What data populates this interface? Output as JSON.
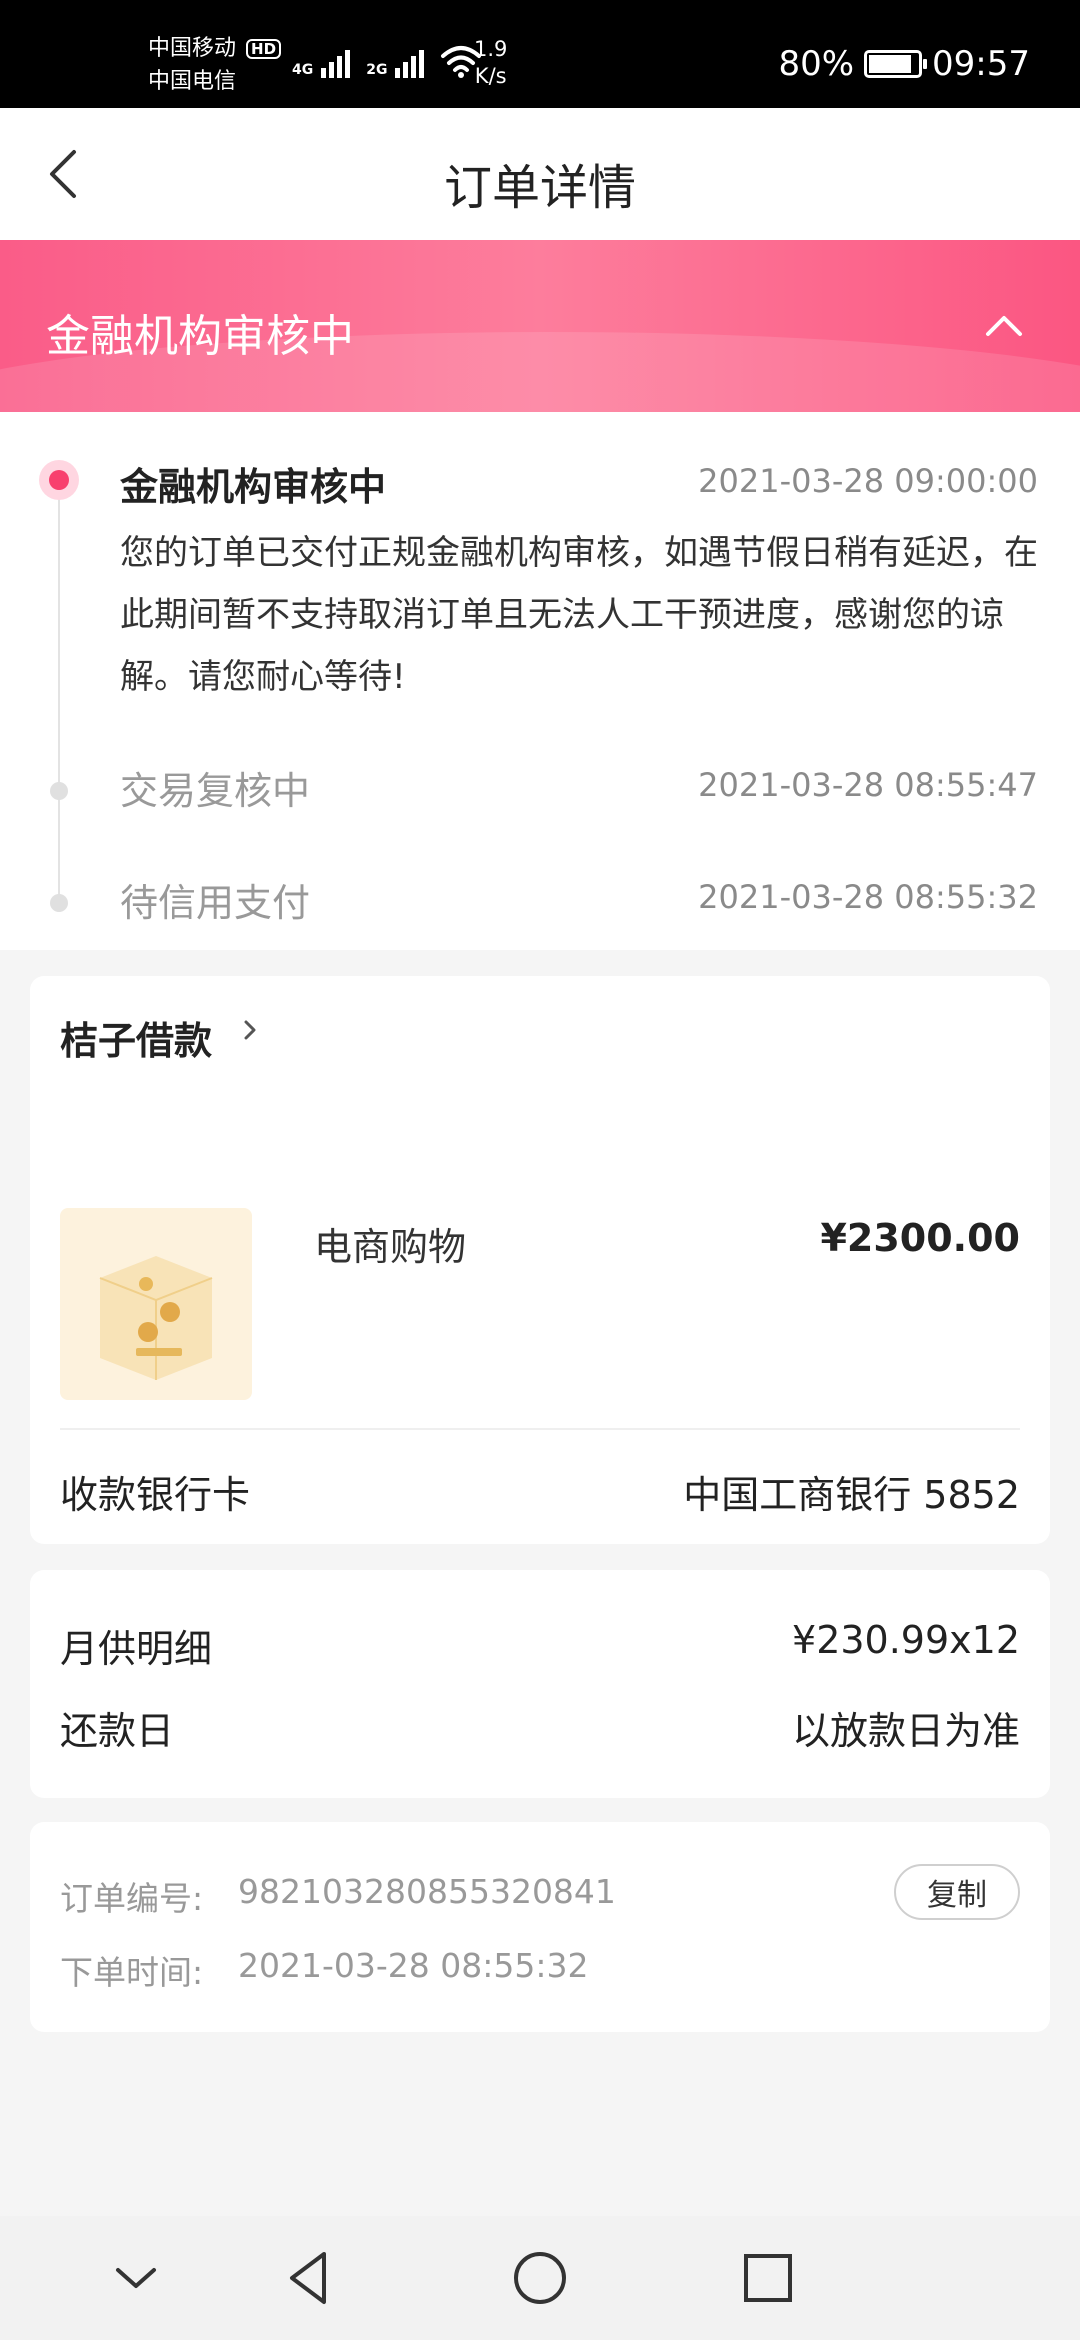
{
  "status_bar": {
    "carrier_1": "中国移动",
    "hd_badge": "HD",
    "carrier_2": "中国电信",
    "net_1": "4G",
    "net_2": "2G",
    "speed_value": "1.9",
    "speed_unit": "K/s",
    "battery_percent": "80%",
    "battery_level": 0.8,
    "time": "09:57"
  },
  "header": {
    "title": "订单详情"
  },
  "banner": {
    "title": "金融机构审核中",
    "background_color": "#fa5c88"
  },
  "timeline": {
    "active": {
      "title": "金融机构审核中",
      "time": "2021-03-28 09:00:00",
      "description": "您的订单已交付正规金融机构审核，如遇节假日稍有延迟，在此期间暂不支持取消订单且无法人工干预进度，感谢您的谅解。请您耐心等待!"
    },
    "steps": [
      {
        "title": "交易复核中",
        "time": "2021-03-28 08:55:47"
      },
      {
        "title": "待信用支付",
        "time": "2021-03-28 08:55:32"
      }
    ]
  },
  "loan_card": {
    "title": "桔子借款",
    "product_name": "电商购物",
    "price": "¥2300.00",
    "bank_label": "收款银行卡",
    "bank_value": "中国工商银行 5852"
  },
  "repay_card": {
    "monthly_label": "月供明细",
    "monthly_value": "¥230.99x12",
    "due_label": "还款日",
    "due_value": "以放款日为准"
  },
  "order_card": {
    "order_no_label": "订单编号:",
    "order_no": "982103280855320841",
    "copy_label": "复制",
    "order_time_label": "下单时间:",
    "order_time": "2021-03-28 08:55:32"
  },
  "colors": {
    "accent": "#f8406e",
    "gold": "#e6b85c"
  }
}
